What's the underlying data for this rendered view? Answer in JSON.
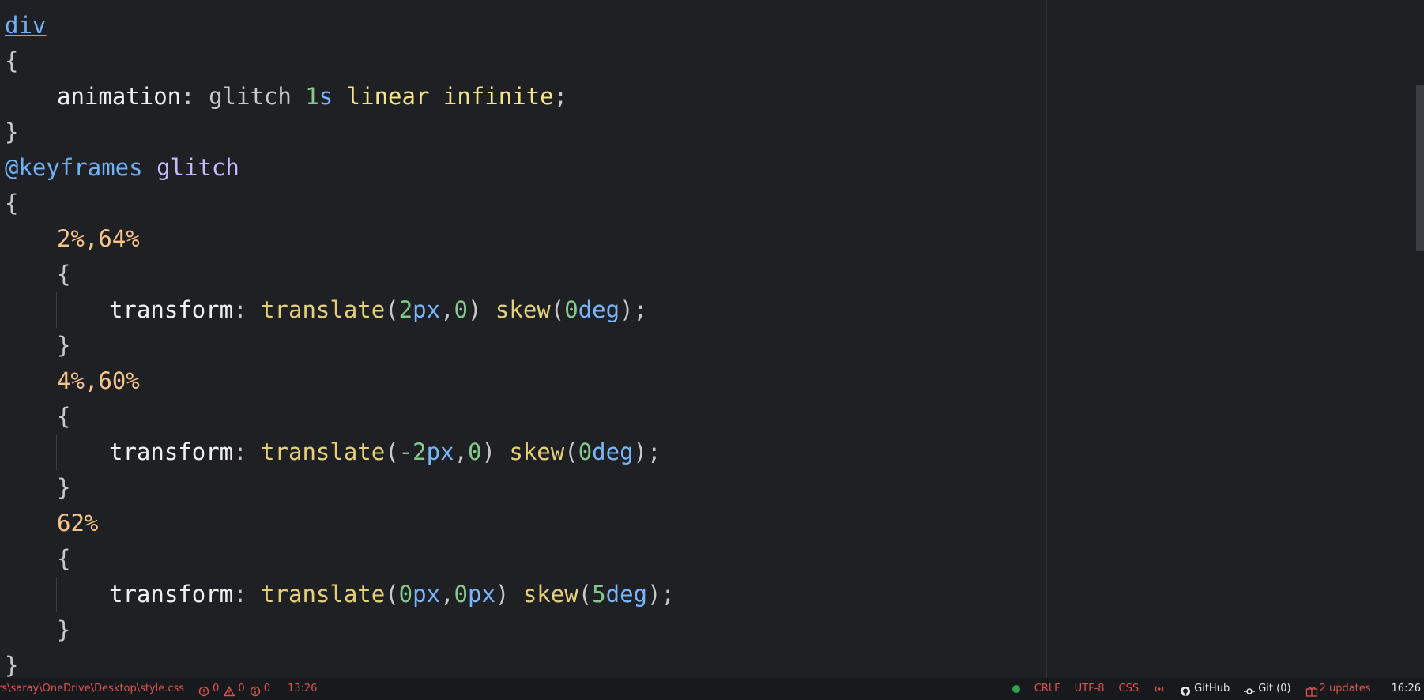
{
  "app": {
    "editor_name": "code-editor"
  },
  "code": {
    "lines": [
      {
        "tokens": [
          {
            "t": "div",
            "c": "tok-selector"
          }
        ],
        "indent": 0
      },
      {
        "tokens": [
          {
            "t": "{",
            "c": "tok-punct"
          }
        ],
        "indent": 0
      },
      {
        "tokens": [
          {
            "t": "animation",
            "c": "tok-prop"
          },
          {
            "t": ": ",
            "c": "tok-punct"
          },
          {
            "t": "glitch ",
            "c": "tok-ident"
          },
          {
            "t": "1",
            "c": "tok-num"
          },
          {
            "t": "s ",
            "c": "tok-unit"
          },
          {
            "t": "linear ",
            "c": "tok-keyword"
          },
          {
            "t": "infinite",
            "c": "tok-keyword"
          },
          {
            "t": ";",
            "c": "tok-punct"
          }
        ],
        "indent": 1
      },
      {
        "tokens": [
          {
            "t": "}",
            "c": "tok-punct"
          }
        ],
        "indent": 0
      },
      {
        "tokens": [
          {
            "t": "@keyframes ",
            "c": "tok-at"
          },
          {
            "t": "glitch",
            "c": "tok-anim"
          }
        ],
        "indent": 0
      },
      {
        "tokens": [
          {
            "t": "{",
            "c": "tok-punct"
          }
        ],
        "indent": 0
      },
      {
        "tokens": [
          {
            "t": "2%,64%",
            "c": "tok-pct"
          }
        ],
        "indent": 1
      },
      {
        "tokens": [
          {
            "t": "{",
            "c": "tok-punct"
          }
        ],
        "indent": 1
      },
      {
        "tokens": [
          {
            "t": "transform",
            "c": "tok-prop"
          },
          {
            "t": ": ",
            "c": "tok-punct"
          },
          {
            "t": "translate",
            "c": "tok-func"
          },
          {
            "t": "(",
            "c": "tok-punct"
          },
          {
            "t": "2",
            "c": "tok-num"
          },
          {
            "t": "px",
            "c": "tok-unit"
          },
          {
            "t": ",",
            "c": "tok-punct"
          },
          {
            "t": "0",
            "c": "tok-num"
          },
          {
            "t": ") ",
            "c": "tok-punct"
          },
          {
            "t": "skew",
            "c": "tok-func"
          },
          {
            "t": "(",
            "c": "tok-punct"
          },
          {
            "t": "0",
            "c": "tok-num"
          },
          {
            "t": "deg",
            "c": "tok-unit"
          },
          {
            "t": ");",
            "c": "tok-punct"
          }
        ],
        "indent": 2
      },
      {
        "tokens": [
          {
            "t": "}",
            "c": "tok-punct"
          }
        ],
        "indent": 1
      },
      {
        "tokens": [
          {
            "t": "4%,60%",
            "c": "tok-pct"
          }
        ],
        "indent": 1
      },
      {
        "tokens": [
          {
            "t": "{",
            "c": "tok-punct"
          }
        ],
        "indent": 1
      },
      {
        "tokens": [
          {
            "t": "transform",
            "c": "tok-prop"
          },
          {
            "t": ": ",
            "c": "tok-punct"
          },
          {
            "t": "translate",
            "c": "tok-func"
          },
          {
            "t": "(",
            "c": "tok-punct"
          },
          {
            "t": "-2",
            "c": "tok-num"
          },
          {
            "t": "px",
            "c": "tok-unit"
          },
          {
            "t": ",",
            "c": "tok-punct"
          },
          {
            "t": "0",
            "c": "tok-num"
          },
          {
            "t": ") ",
            "c": "tok-punct"
          },
          {
            "t": "skew",
            "c": "tok-func"
          },
          {
            "t": "(",
            "c": "tok-punct"
          },
          {
            "t": "0",
            "c": "tok-num"
          },
          {
            "t": "deg",
            "c": "tok-unit"
          },
          {
            "t": ");",
            "c": "tok-punct"
          }
        ],
        "indent": 2
      },
      {
        "tokens": [
          {
            "t": "}",
            "c": "tok-punct"
          }
        ],
        "indent": 1
      },
      {
        "tokens": [
          {
            "t": "62%",
            "c": "tok-pct"
          }
        ],
        "indent": 1
      },
      {
        "tokens": [
          {
            "t": "{",
            "c": "tok-punct"
          }
        ],
        "indent": 1
      },
      {
        "tokens": [
          {
            "t": "transform",
            "c": "tok-prop"
          },
          {
            "t": ": ",
            "c": "tok-punct"
          },
          {
            "t": "translate",
            "c": "tok-func"
          },
          {
            "t": "(",
            "c": "tok-punct"
          },
          {
            "t": "0",
            "c": "tok-num"
          },
          {
            "t": "px",
            "c": "tok-unit"
          },
          {
            "t": ",",
            "c": "tok-punct"
          },
          {
            "t": "0",
            "c": "tok-num"
          },
          {
            "t": "px",
            "c": "tok-unit"
          },
          {
            "t": ") ",
            "c": "tok-punct"
          },
          {
            "t": "skew",
            "c": "tok-func"
          },
          {
            "t": "(",
            "c": "tok-punct"
          },
          {
            "t": "5",
            "c": "tok-num"
          },
          {
            "t": "deg",
            "c": "tok-unit"
          },
          {
            "t": ");",
            "c": "tok-punct"
          }
        ],
        "indent": 2
      },
      {
        "tokens": [
          {
            "t": "}",
            "c": "tok-punct"
          }
        ],
        "indent": 1
      },
      {
        "tokens": [
          {
            "t": "}",
            "c": "tok-punct"
          }
        ],
        "indent": 0
      }
    ]
  },
  "status_bar": {
    "file_path": "rs\\saray\\OneDrive\\Desktop\\style.css",
    "errors": "0",
    "warnings": "0",
    "infos": "0",
    "cursor": "13:26",
    "line_ending": "CRLF",
    "encoding": "UTF-8",
    "grammar": "CSS",
    "github_label": "GitHub",
    "git_label": "Git (0)",
    "updates_label": "2 updates",
    "clock": "16:26"
  },
  "colors": {
    "background": "#1f2023",
    "status_background": "#18191c",
    "status_accent": "#d9534f"
  }
}
